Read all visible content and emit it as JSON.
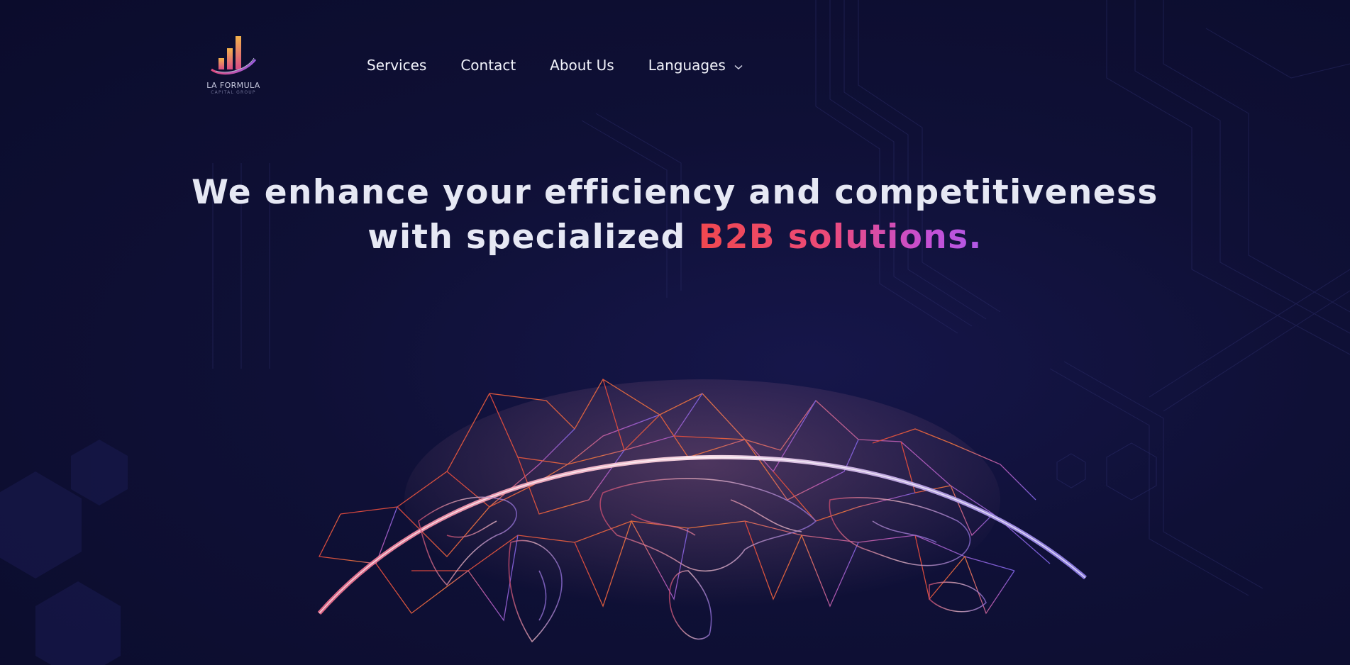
{
  "brand": {
    "name": "LA FORMULA",
    "tagline": "CAPITAL GROUP"
  },
  "nav": {
    "items": [
      {
        "label": "Services"
      },
      {
        "label": "Contact"
      },
      {
        "label": "About Us"
      },
      {
        "label": "Languages"
      }
    ]
  },
  "hero": {
    "line1": "We enhance your efficiency and competitiveness",
    "line2_prefix": "with specialized ",
    "line2_highlight": "B2B solutions."
  },
  "colors": {
    "background": "#0e0f30",
    "headline": "#e6e8f4",
    "accent_start": "#f0484f",
    "accent_end": "#b15ae8"
  },
  "icons": {
    "languages_dropdown": "chevron-down-icon",
    "logo": "bar-chart-logo-icon"
  }
}
